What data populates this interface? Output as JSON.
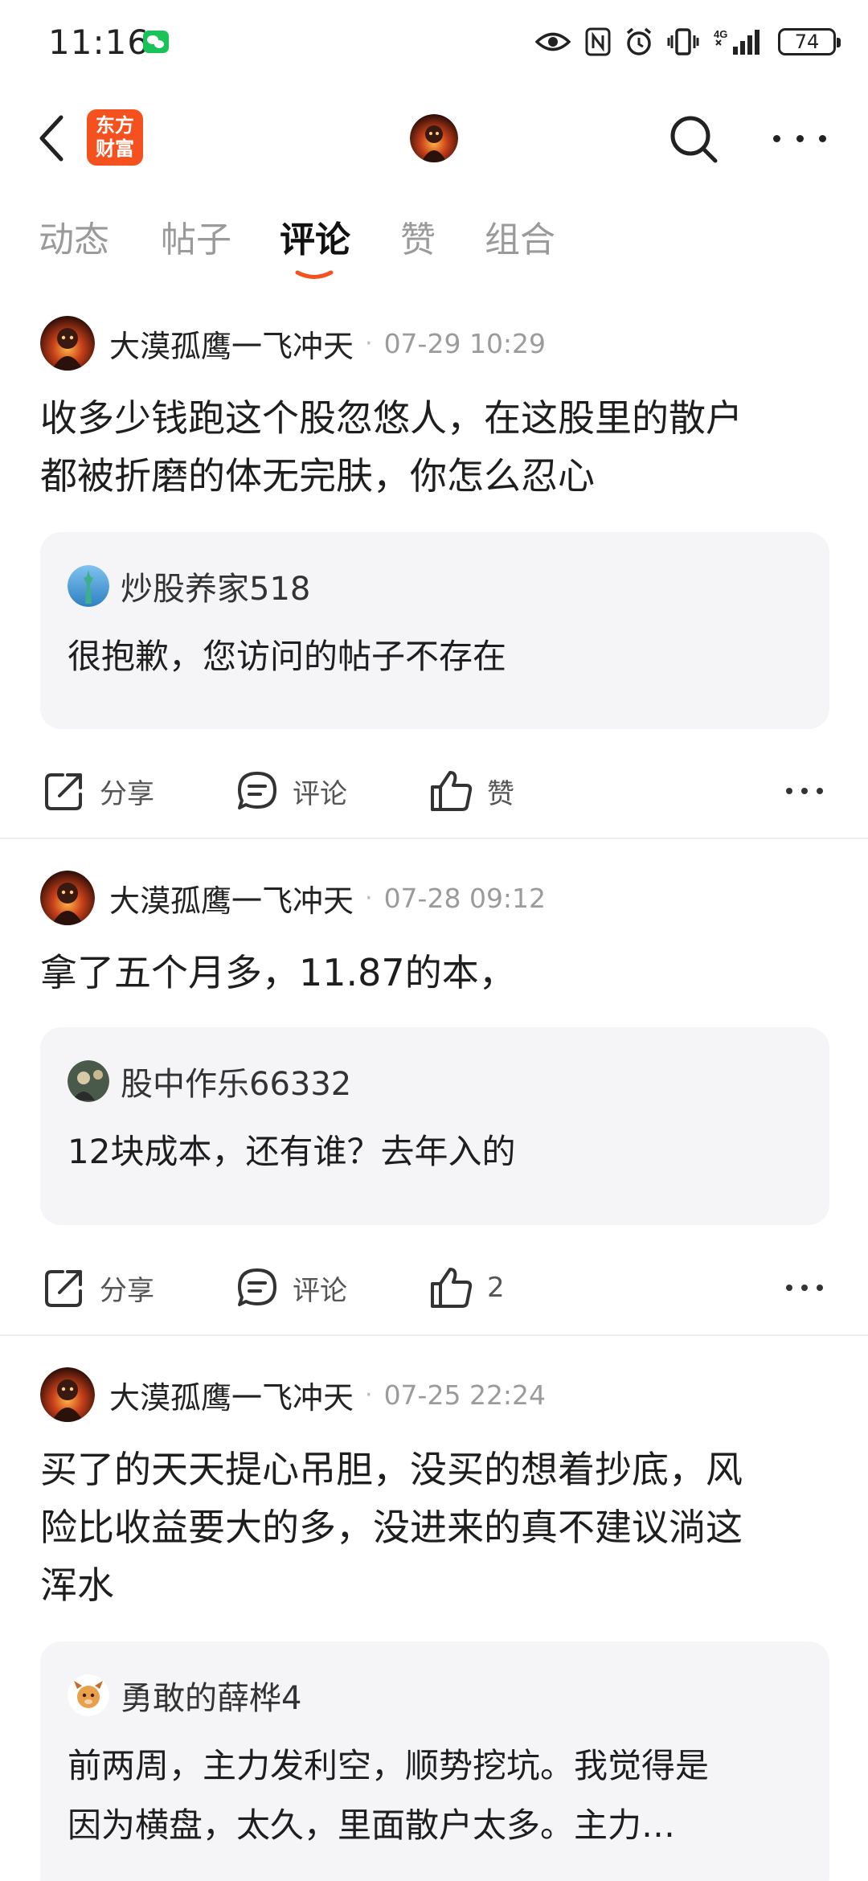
{
  "status_bar": {
    "time": "11:16",
    "battery": "74",
    "network": "4G",
    "icons": [
      "wechat-icon",
      "eye-icon",
      "nfc-icon",
      "alarm-icon",
      "vibrate-icon",
      "signal-icon",
      "battery-icon"
    ]
  },
  "header": {
    "logo_text_line1": "东方",
    "logo_text_line2": "财富",
    "brand_color": "#f4511e"
  },
  "tabs": [
    {
      "label": "动态",
      "active": false
    },
    {
      "label": "帖子",
      "active": false
    },
    {
      "label": "评论",
      "active": true
    },
    {
      "label": "赞",
      "active": false
    },
    {
      "label": "组合",
      "active": false
    }
  ],
  "posts": [
    {
      "author": "大漠孤鹰一飞冲天",
      "time": "07-29 10:29",
      "text_lines": [
        "收多少钱跑这个股忽悠人，在这股里的散户",
        "都被折磨的体无完肤，你怎么忍心"
      ],
      "quote": {
        "name": "炒股养家518",
        "text_lines": [
          "很抱歉，您访问的帖子不存在"
        ]
      },
      "actions": {
        "share": "分享",
        "comment": "评论",
        "like": "赞"
      }
    },
    {
      "author": "大漠孤鹰一飞冲天",
      "time": "07-28 09:12",
      "text_lines": [
        "拿了五个月多，11.87的本，"
      ],
      "quote": {
        "name": "股中作乐66332",
        "text_lines": [
          "12块成本，还有谁？去年入的"
        ]
      },
      "actions": {
        "share": "分享",
        "comment": "评论",
        "like": "2"
      }
    },
    {
      "author": "大漠孤鹰一飞冲天",
      "time": "07-25 22:24",
      "text_lines": [
        "买了的天天提心吊胆，没买的想着抄底，风",
        "险比收益要大的多，没进来的真不建议淌这",
        "浑水"
      ],
      "quote": {
        "name": "勇敢的薛桦4",
        "text_lines": [
          "前两周，主力发利空，顺势挖坑。我觉得是",
          "因为横盘，太久，里面散户太多。主力…"
        ]
      }
    }
  ]
}
